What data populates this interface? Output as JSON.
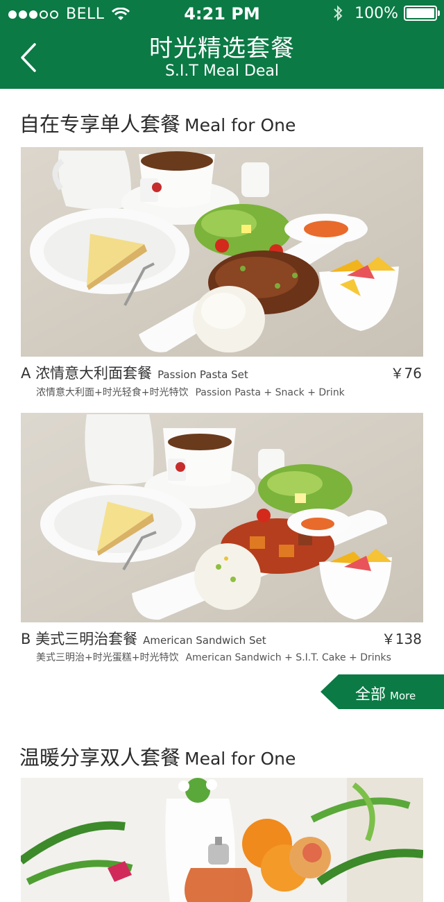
{
  "status_bar": {
    "carrier": "BELL",
    "time": "4:21 PM",
    "battery": "100%"
  },
  "nav": {
    "title": "时光精选套餐",
    "subtitle": "S.I.T Meal Deal"
  },
  "sections": [
    {
      "title_cn": "自在专享单人套餐",
      "title_en": "Meal for One",
      "items": [
        {
          "letter": "A",
          "name_cn": "浓情意大利面套餐",
          "name_en": "Passion Pasta Set",
          "price": "￥76",
          "desc_cn": "浓情意大利面+时光轻食+时光特饮",
          "desc_en": "Passion Pasta + Snack + Drink"
        },
        {
          "letter": "B",
          "name_cn": "美式三明治套餐",
          "name_en": "American Sandwich Set",
          "price": "￥138",
          "desc_cn": "美式三明治+时光蛋糕+时光特饮",
          "desc_en": "American Sandwich  + S.I.T. Cake +  Drinks"
        }
      ],
      "more_cn": "全部",
      "more_en": "More"
    },
    {
      "title_cn": "温暖分享双人套餐",
      "title_en": "Meal for One"
    }
  ],
  "colors": {
    "brand_green": "#0b7a45"
  }
}
